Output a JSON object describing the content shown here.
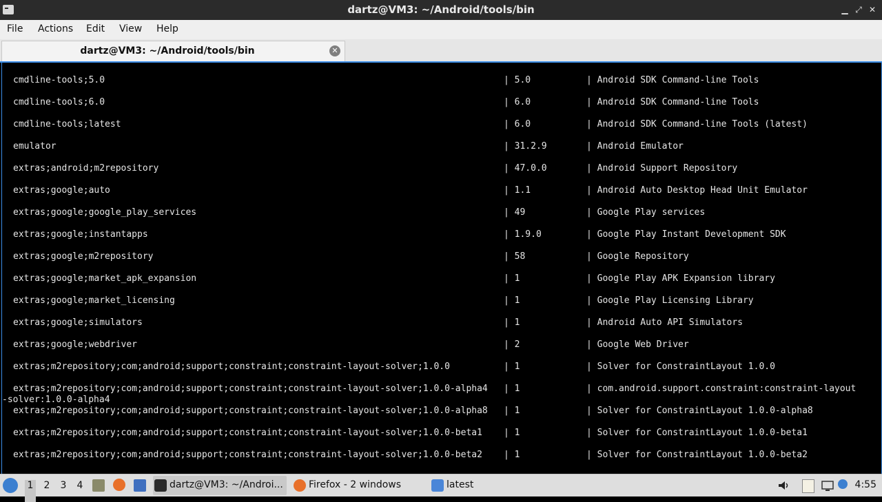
{
  "window": {
    "title": "dartz@VM3: ~/Android/tools/bin",
    "minimize": "▁",
    "maximize": "⤢",
    "close": "✕"
  },
  "menu": [
    "File",
    "Actions",
    "Edit",
    "View",
    "Help"
  ],
  "tab": {
    "label": "dartz@VM3: ~/Android/tools/bin",
    "close": "✕"
  },
  "terminal": {
    "rows": [
      [
        "cmdline-tools;5.0",
        "| 5.0",
        "| Android SDK Command-line Tools"
      ],
      [
        "cmdline-tools;6.0",
        "| 6.0",
        "| Android SDK Command-line Tools"
      ],
      [
        "cmdline-tools;latest",
        "| 6.0",
        "| Android SDK Command-line Tools (latest)"
      ],
      [
        "emulator",
        "| 31.2.9",
        "| Android Emulator"
      ],
      [
        "extras;android;m2repository",
        "| 47.0.0",
        "| Android Support Repository"
      ],
      [
        "extras;google;auto",
        "| 1.1",
        "| Android Auto Desktop Head Unit Emulator"
      ],
      [
        "extras;google;google_play_services",
        "| 49",
        "| Google Play services"
      ],
      [
        "extras;google;instantapps",
        "| 1.9.0",
        "| Google Play Instant Development SDK"
      ],
      [
        "extras;google;m2repository",
        "| 58",
        "| Google Repository"
      ],
      [
        "extras;google;market_apk_expansion",
        "| 1",
        "| Google Play APK Expansion library"
      ],
      [
        "extras;google;market_licensing",
        "| 1",
        "| Google Play Licensing Library"
      ],
      [
        "extras;google;simulators",
        "| 1",
        "| Android Auto API Simulators"
      ],
      [
        "extras;google;webdriver",
        "| 2",
        "| Google Web Driver"
      ],
      [
        "extras;m2repository;com;android;support;constraint;constraint-layout-solver;1.0.0",
        "| 1",
        "| Solver for ConstraintLayout 1.0.0"
      ],
      [
        "extras;m2repository;com;android;support;constraint;constraint-layout-solver;1.0.0-alpha4",
        "| 1",
        "| com.android.support.constraint:constraint-layout"
      ],
      [
        "extras;m2repository;com;android;support;constraint;constraint-layout-solver;1.0.0-alpha8",
        "| 1",
        "| Solver for ConstraintLayout 1.0.0-alpha8"
      ],
      [
        "extras;m2repository;com;android;support;constraint;constraint-layout-solver;1.0.0-beta1",
        "| 1",
        "| Solver for ConstraintLayout 1.0.0-beta1"
      ],
      [
        "extras;m2repository;com;android;support;constraint;constraint-layout-solver;1.0.0-beta2",
        "| 1",
        "| Solver for ConstraintLayout 1.0.0-beta2"
      ]
    ],
    "wrapped_line": "-solver:1.0.0-alpha4"
  },
  "taskbar": {
    "desktops": [
      "1",
      "2",
      "3",
      "4"
    ],
    "tasks": [
      {
        "label": "dartz@VM3: ~/Androi...",
        "icon": "terminal-icon"
      },
      {
        "label": "Firefox - 2 windows",
        "icon": "firefox-icon"
      },
      {
        "label": "latest",
        "icon": "folder-icon"
      }
    ],
    "clock": "4:55"
  },
  "colors": {
    "accent": "#3d8ee8",
    "terminal_bg": "#000000",
    "terminal_fg": "#e6e6e6"
  }
}
